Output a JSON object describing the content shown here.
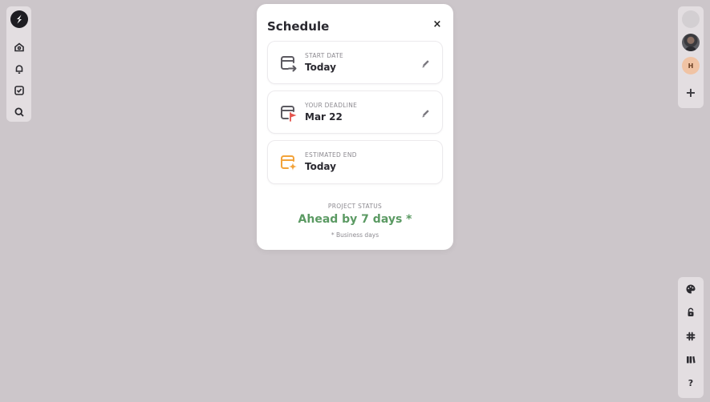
{
  "left_sidebar": {
    "items": [
      {
        "icon": "home-icon"
      },
      {
        "icon": "bell-icon"
      },
      {
        "icon": "checkbox-icon"
      },
      {
        "icon": "search-icon"
      }
    ]
  },
  "right_top": {
    "avatar_initial": "H",
    "add_label": "+"
  },
  "right_bottom": {
    "help_label": "?"
  },
  "modal": {
    "title": "Schedule",
    "close_label": "×",
    "cards": [
      {
        "label": "START DATE",
        "value": "Today",
        "icon": "calendar-arrow-icon",
        "editable": true
      },
      {
        "label": "YOUR DEADLINE",
        "value": "Mar 22",
        "icon": "calendar-flag-icon",
        "editable": true
      },
      {
        "label": "ESTIMATED END",
        "value": "Today",
        "icon": "calendar-sparkle-icon",
        "editable": false
      }
    ],
    "status": {
      "label": "PROJECT STATUS",
      "value": "Ahead by 7 days *",
      "note": "* Business days",
      "color": "#5b9a63"
    }
  },
  "colors": {
    "background": "#ccc6ca",
    "accent_red": "#e4534c",
    "accent_orange": "#f3a33a"
  }
}
